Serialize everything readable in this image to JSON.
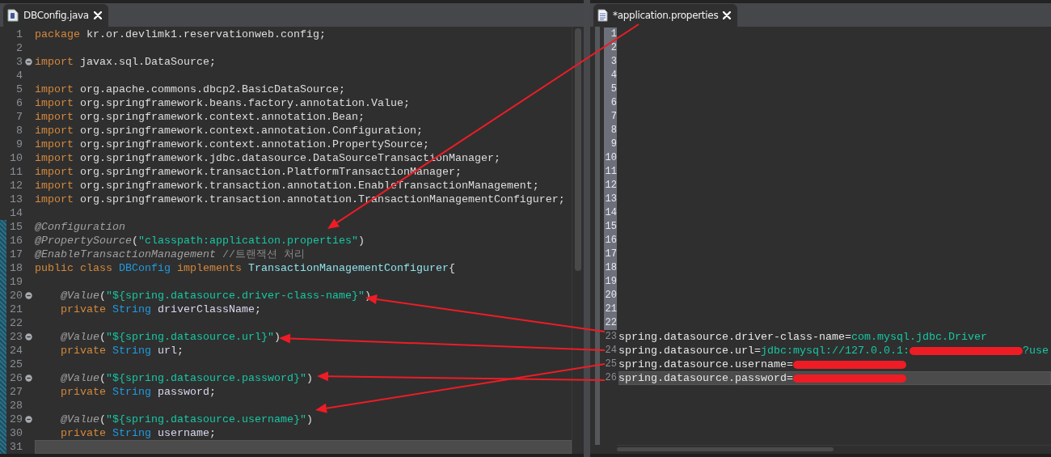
{
  "left_editor": {
    "tab": {
      "title": "DBConfig.java",
      "selected": true
    },
    "lines": [
      {
        "number": "1",
        "fold": false,
        "current": false,
        "changed": false,
        "tokens": [
          {
            "kind": "kw",
            "text": "package"
          },
          {
            "kind": "plain",
            "text": " kr.or.devlimk1.reservationweb.config;"
          }
        ]
      },
      {
        "number": "2",
        "fold": false,
        "current": false,
        "changed": false
      },
      {
        "number": "3",
        "fold": true,
        "current": false,
        "changed": false,
        "tokens": [
          {
            "kind": "kw",
            "text": "import"
          },
          {
            "kind": "plain",
            "text": " javax.sql.DataSource;"
          }
        ]
      },
      {
        "number": "4",
        "fold": false,
        "current": false,
        "changed": false
      },
      {
        "number": "5",
        "fold": false,
        "current": false,
        "changed": false,
        "tokens": [
          {
            "kind": "kw",
            "text": "import"
          },
          {
            "kind": "plain",
            "text": " org.apache.commons.dbcp2.BasicDataSource;"
          }
        ]
      },
      {
        "number": "6",
        "fold": false,
        "current": false,
        "changed": false,
        "tokens": [
          {
            "kind": "kw",
            "text": "import"
          },
          {
            "kind": "plain",
            "text": " org.springframework.beans.factory.annotation.Value;"
          }
        ]
      },
      {
        "number": "7",
        "fold": false,
        "current": false,
        "changed": false,
        "tokens": [
          {
            "kind": "kw",
            "text": "import"
          },
          {
            "kind": "plain",
            "text": " org.springframework.context.annotation.Bean;"
          }
        ]
      },
      {
        "number": "8",
        "fold": false,
        "current": false,
        "changed": false,
        "tokens": [
          {
            "kind": "kw",
            "text": "import"
          },
          {
            "kind": "plain",
            "text": " org.springframework.context.annotation.Configuration;"
          }
        ]
      },
      {
        "number": "9",
        "fold": false,
        "current": false,
        "changed": false,
        "tokens": [
          {
            "kind": "kw",
            "text": "import"
          },
          {
            "kind": "plain",
            "text": " org.springframework.context.annotation.PropertySource;"
          }
        ]
      },
      {
        "number": "10",
        "fold": false,
        "current": false,
        "changed": false,
        "tokens": [
          {
            "kind": "kw",
            "text": "import"
          },
          {
            "kind": "plain",
            "text": " org.springframework.jdbc.datasource.DataSourceTransactionManager;"
          }
        ]
      },
      {
        "number": "11",
        "fold": false,
        "current": false,
        "changed": false,
        "tokens": [
          {
            "kind": "kw",
            "text": "import"
          },
          {
            "kind": "plain",
            "text": " org.springframework.transaction.PlatformTransactionManager;"
          }
        ]
      },
      {
        "number": "12",
        "fold": false,
        "current": false,
        "changed": false,
        "tokens": [
          {
            "kind": "kw",
            "text": "import"
          },
          {
            "kind": "plain",
            "text": " org.springframework.transaction.annotation.EnableTransactionManagement;"
          }
        ]
      },
      {
        "number": "13",
        "fold": false,
        "current": false,
        "changed": false,
        "tokens": [
          {
            "kind": "kw",
            "text": "import"
          },
          {
            "kind": "plain",
            "text": " org.springframework.transaction.annotation.TransactionManagementConfigurer;"
          }
        ]
      },
      {
        "number": "14",
        "fold": false,
        "current": false,
        "changed": false
      },
      {
        "number": "15",
        "fold": false,
        "current": false,
        "changed": true,
        "tokens": [
          {
            "kind": "ann",
            "text": "@Configuration"
          }
        ]
      },
      {
        "number": "16",
        "fold": false,
        "current": false,
        "changed": true,
        "tokens": [
          {
            "kind": "ann",
            "text": "@PropertySource"
          },
          {
            "kind": "plain",
            "text": "("
          },
          {
            "kind": "str",
            "text": "\"classpath:application.properties\""
          },
          {
            "kind": "plain",
            "text": ")"
          }
        ]
      },
      {
        "number": "17",
        "fold": false,
        "current": false,
        "changed": true,
        "tokens": [
          {
            "kind": "ann",
            "text": "@EnableTransactionManagement"
          },
          {
            "kind": "comment",
            "text": " //트랜잭션 처리"
          }
        ]
      },
      {
        "number": "18",
        "fold": false,
        "current": false,
        "changed": true,
        "tokens": [
          {
            "kind": "kw",
            "text": "public class "
          },
          {
            "kind": "type",
            "text": "DBConfig"
          },
          {
            "kind": "kw",
            "text": " implements "
          },
          {
            "kind": "iface",
            "text": "TransactionManagementConfigurer"
          },
          {
            "kind": "plain",
            "text": "{"
          }
        ]
      },
      {
        "number": "19",
        "fold": false,
        "current": false,
        "changed": true
      },
      {
        "number": "20",
        "fold": true,
        "current": false,
        "changed": true,
        "tokens": [
          {
            "kind": "ann",
            "text": "    @Value"
          },
          {
            "kind": "plain",
            "text": "("
          },
          {
            "kind": "str",
            "text": "\"${spring.datasource.driver-class-name}\""
          },
          {
            "kind": "plain",
            "text": ")"
          }
        ]
      },
      {
        "number": "21",
        "fold": false,
        "current": false,
        "changed": true,
        "tokens": [
          {
            "kind": "kw",
            "text": "    private "
          },
          {
            "kind": "type",
            "text": "String"
          },
          {
            "kind": "field",
            "text": " driverClassName"
          },
          {
            "kind": "plain",
            "text": ";"
          }
        ]
      },
      {
        "number": "22",
        "fold": false,
        "current": false,
        "changed": true
      },
      {
        "number": "23",
        "fold": true,
        "current": false,
        "changed": true,
        "tokens": [
          {
            "kind": "ann",
            "text": "    @Value"
          },
          {
            "kind": "plain",
            "text": "("
          },
          {
            "kind": "str",
            "text": "\"${spring.datasource.url}\""
          },
          {
            "kind": "plain",
            "text": ")"
          }
        ]
      },
      {
        "number": "24",
        "fold": false,
        "current": false,
        "changed": true,
        "tokens": [
          {
            "kind": "kw",
            "text": "    private "
          },
          {
            "kind": "type",
            "text": "String"
          },
          {
            "kind": "field",
            "text": " url"
          },
          {
            "kind": "plain",
            "text": ";"
          }
        ]
      },
      {
        "number": "25",
        "fold": false,
        "current": false,
        "changed": true
      },
      {
        "number": "26",
        "fold": true,
        "current": false,
        "changed": true,
        "tokens": [
          {
            "kind": "ann",
            "text": "    @Value"
          },
          {
            "kind": "plain",
            "text": "("
          },
          {
            "kind": "str",
            "text": "\"${spring.datasource.password}\""
          },
          {
            "kind": "plain",
            "text": ")"
          }
        ]
      },
      {
        "number": "27",
        "fold": false,
        "current": false,
        "changed": true,
        "tokens": [
          {
            "kind": "kw",
            "text": "    private "
          },
          {
            "kind": "type",
            "text": "String"
          },
          {
            "kind": "field",
            "text": " password"
          },
          {
            "kind": "plain",
            "text": ";"
          }
        ]
      },
      {
        "number": "28",
        "fold": false,
        "current": false,
        "changed": true
      },
      {
        "number": "29",
        "fold": true,
        "current": false,
        "changed": true,
        "tokens": [
          {
            "kind": "ann",
            "text": "    @Value"
          },
          {
            "kind": "plain",
            "text": "("
          },
          {
            "kind": "str",
            "text": "\"${spring.datasource.username}\""
          },
          {
            "kind": "plain",
            "text": ")"
          }
        ]
      },
      {
        "number": "30",
        "fold": false,
        "current": false,
        "changed": true,
        "tokens": [
          {
            "kind": "kw",
            "text": "    private "
          },
          {
            "kind": "type",
            "text": "String"
          },
          {
            "kind": "field",
            "text": " username"
          },
          {
            "kind": "plain",
            "text": ";"
          }
        ]
      },
      {
        "number": "31",
        "fold": false,
        "current": true,
        "changed": true
      }
    ]
  },
  "right_editor": {
    "tab": {
      "title": "*application.properties",
      "selected": true
    },
    "lines": [
      {
        "number": "1",
        "marked": true,
        "current": false
      },
      {
        "number": "2",
        "marked": true,
        "current": false
      },
      {
        "number": "3",
        "marked": true,
        "current": false
      },
      {
        "number": "4",
        "marked": true,
        "current": false
      },
      {
        "number": "5",
        "marked": true,
        "current": false
      },
      {
        "number": "6",
        "marked": true,
        "current": false
      },
      {
        "number": "7",
        "marked": true,
        "current": false
      },
      {
        "number": "8",
        "marked": true,
        "current": false
      },
      {
        "number": "9",
        "marked": true,
        "current": false
      },
      {
        "number": "10",
        "marked": true,
        "current": false
      },
      {
        "number": "11",
        "marked": true,
        "current": false
      },
      {
        "number": "12",
        "marked": true,
        "current": false
      },
      {
        "number": "13",
        "marked": true,
        "current": false
      },
      {
        "number": "14",
        "marked": true,
        "current": false
      },
      {
        "number": "15",
        "marked": true,
        "current": false
      },
      {
        "number": "16",
        "marked": true,
        "current": false
      },
      {
        "number": "17",
        "marked": true,
        "current": false
      },
      {
        "number": "18",
        "marked": true,
        "current": false
      },
      {
        "number": "19",
        "marked": true,
        "current": false
      },
      {
        "number": "20",
        "marked": true,
        "current": false
      },
      {
        "number": "21",
        "marked": true,
        "current": false
      },
      {
        "number": "22",
        "marked": true,
        "current": false
      },
      {
        "number": "23",
        "marked": false,
        "current": false,
        "tokens": [
          {
            "kind": "key",
            "text": "spring.datasource.driver-class-name="
          },
          {
            "kind": "value",
            "text": "com.mysql.jdbc.Driver"
          }
        ]
      },
      {
        "number": "24",
        "marked": false,
        "current": false,
        "tokens": [
          {
            "kind": "key",
            "text": "spring.datasource.url="
          },
          {
            "kind": "value",
            "text": "jdbc:mysql://127.0.0.1:"
          },
          {
            "kind": "redacted"
          },
          {
            "kind": "value",
            "text": "?use"
          }
        ]
      },
      {
        "number": "25",
        "marked": false,
        "current": false,
        "tokens": [
          {
            "kind": "key",
            "text": "spring.datasource.username="
          },
          {
            "kind": "redacted"
          }
        ]
      },
      {
        "number": "26",
        "marked": false,
        "current": true,
        "tokens": [
          {
            "kind": "key",
            "text": "spring.datasource.password="
          },
          {
            "kind": "redacted"
          }
        ]
      }
    ]
  }
}
